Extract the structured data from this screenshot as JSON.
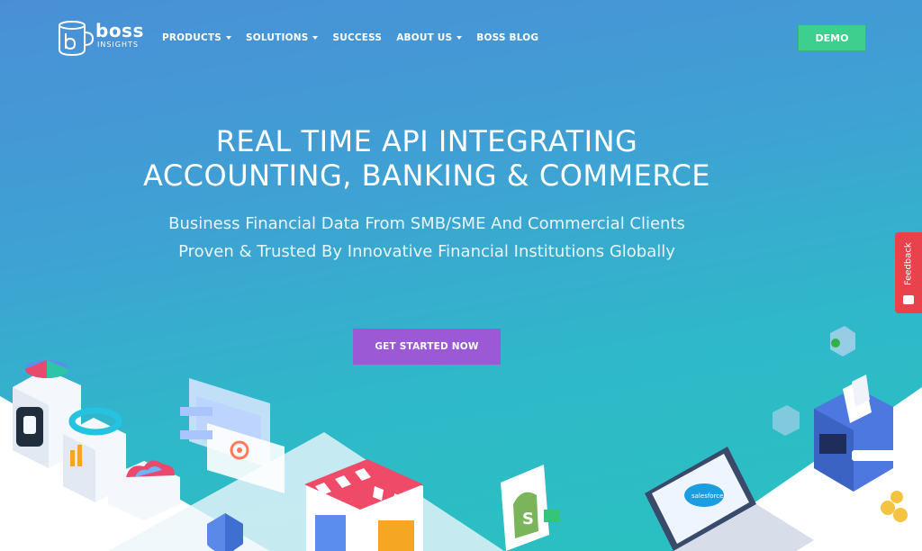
{
  "header": {
    "logo_word": "boss",
    "logo_sub": "INSIGHTS",
    "nav": [
      {
        "label": "PRODUCTS",
        "dropdown": true
      },
      {
        "label": "SOLUTIONS",
        "dropdown": true
      },
      {
        "label": "SUCCESS",
        "dropdown": false
      },
      {
        "label": "ABOUT US",
        "dropdown": true
      },
      {
        "label": "BOSS BLOG",
        "dropdown": false
      }
    ],
    "demo_label": "DEMO"
  },
  "hero": {
    "title_line1": "REAL TIME API INTEGRATING",
    "title_line2": "ACCOUNTING, BANKING & COMMERCE",
    "subtitle_line1": "Business Financial Data From SMB/SME And Commercial Clients",
    "subtitle_line2": "Proven & Trusted By Innovative Financial Institutions Globally",
    "cta_label": "GET STARTED NOW"
  },
  "feedback": {
    "label": "Feedback"
  },
  "illustration": {
    "laptop_brand": "salesforce"
  },
  "colors": {
    "demo_button": "#3ecf8e",
    "cta_button": "#9b59d6",
    "feedback_tab": "#e8424d",
    "background_top": "#4a8fd6",
    "background_bottom": "#29c2c0"
  }
}
